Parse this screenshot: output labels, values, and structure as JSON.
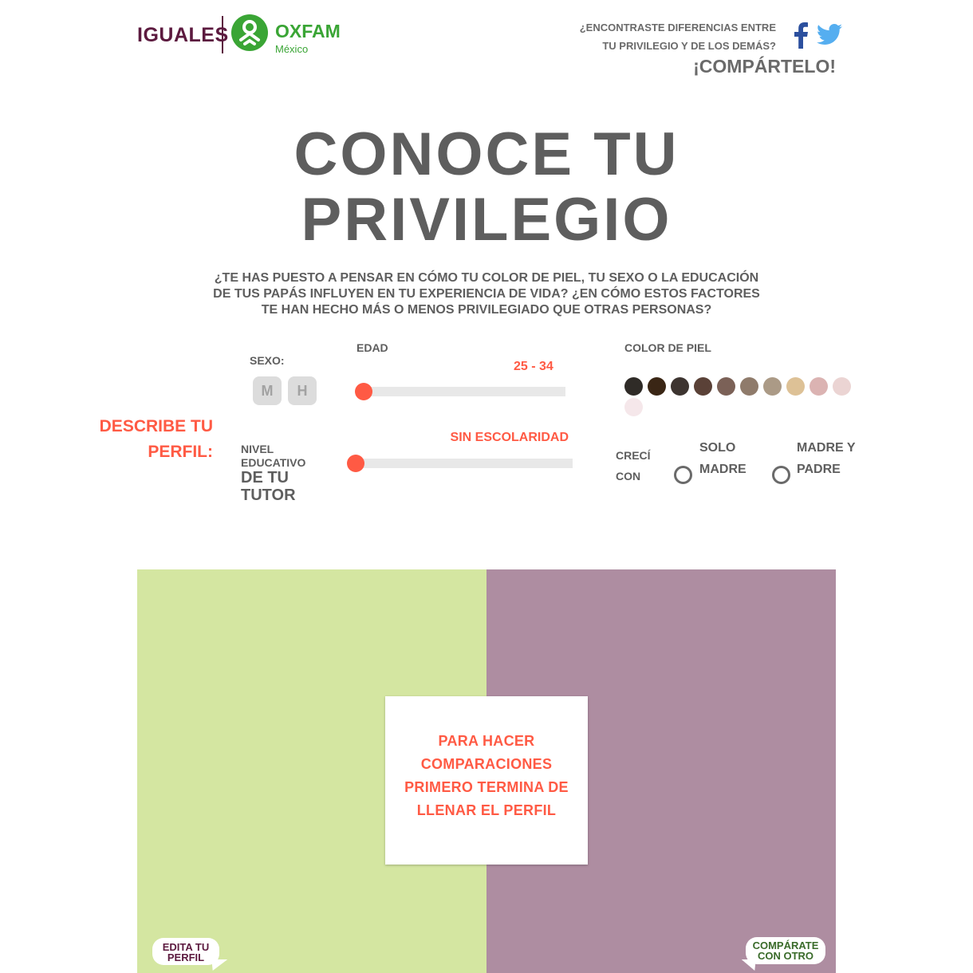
{
  "header": {
    "logo_iguales": "IGUALES",
    "logo_oxfam": "OXFAM",
    "logo_country": "México",
    "share_question_line1": "¿ENCONTRASTE DIFERENCIAS ENTRE",
    "share_question_line2": "TU PRIVILEGIO Y DE LOS DEMÁS?",
    "share_cta": "¡COMPÁRTELO!",
    "social_icons": [
      "facebook-icon",
      "twitter-icon"
    ],
    "colors": {
      "iguales": "#5c1a3f",
      "oxfam": "#3aa535",
      "facebook": "#2b4f9e",
      "twitter": "#55aef0"
    }
  },
  "hero": {
    "title_line1": "CONOCE TU",
    "title_line2": "PRIVILEGIO",
    "intro": "¿TE HAS PUESTO A PENSAR EN CÓMO TU COLOR DE PIEL, TU SEXO O LA EDUCACIÓN DE TUS PAPÁS INFLUYEN EN TU EXPERIENCIA DE VIDA? ¿EN CÓMO ESTOS FACTORES TE HAN HECHO MÁS O MENOS PRIVILEGIADO QUE OTRAS PERSONAS?"
  },
  "profile": {
    "describe_line1": "DESCRIBE TU",
    "describe_line2": "PERFIL:",
    "sexo_label": "SEXO:",
    "sexo_options": [
      "M",
      "H"
    ],
    "edad_label": "EDAD",
    "edad_value": "25 - 34",
    "edad_level": 0,
    "nivel_line1": "NIVEL",
    "nivel_line2": "EDUCATIVO",
    "nivel_line3": "DE TU",
    "nivel_line4": "TUTOR",
    "nivel_value": "SIN ESCOLARIDAD",
    "nivel_level": 0,
    "piel_label": "COLOR DE PIEL",
    "skin_colors": [
      "#2f2b27",
      "#3a2615",
      "#3d3430",
      "#5a4137",
      "#7b6157",
      "#8f7b6b",
      "#ab9a86",
      "#ddc196",
      "#dbb3b2",
      "#ebd4d3",
      "#f5e7ea"
    ],
    "creci_line1": "CRECÍ",
    "creci_line2": "CON",
    "option_solo_line1": "SOLO",
    "option_solo_line2": "MADRE",
    "option_mp_line1": "MADRE Y",
    "option_mp_line2": "PADRE",
    "accent": "#ff5a44"
  },
  "compare": {
    "notice_line1": "PARA HACER",
    "notice_line2": "COMPARACIONES",
    "notice_line3": "PRIMERO TERMINA DE",
    "notice_line4": "LLENAR EL PERFIL",
    "edit_line1": "EDITA TU",
    "edit_line2": "PERFIL",
    "compare_line1": "COMPÁRATE",
    "compare_line2": "CON OTRO",
    "left_color": "#d4e6a1",
    "right_color": "#ae8da1"
  }
}
